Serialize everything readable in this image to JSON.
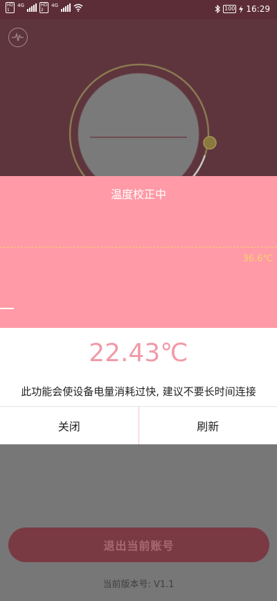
{
  "status_bar": {
    "time": "16:29",
    "battery": "100",
    "sim1_label": [
      "HD",
      "1"
    ],
    "sim2_label": [
      "HD",
      "2"
    ],
    "network": "4G",
    "icons": [
      "signal-icon",
      "wifi-icon",
      "bluetooth-icon",
      "battery-icon",
      "charging-icon"
    ]
  },
  "app": {
    "logout_label": "退出当前账号",
    "version_label": "当前版本号: V1.1"
  },
  "dialog": {
    "title": "温度校正中",
    "reference_temp": "36.6℃",
    "current_temp": "22.43℃",
    "warning": "此功能会使设备电量消耗过快, 建议不要长时间连接",
    "close_label": "关闭",
    "refresh_label": "刷新"
  },
  "colors": {
    "dialog_pink": "#ff9aa6",
    "temp_text": "#f09aa8",
    "reference_line": "#f7d46a",
    "app_header": "#5e353d"
  }
}
